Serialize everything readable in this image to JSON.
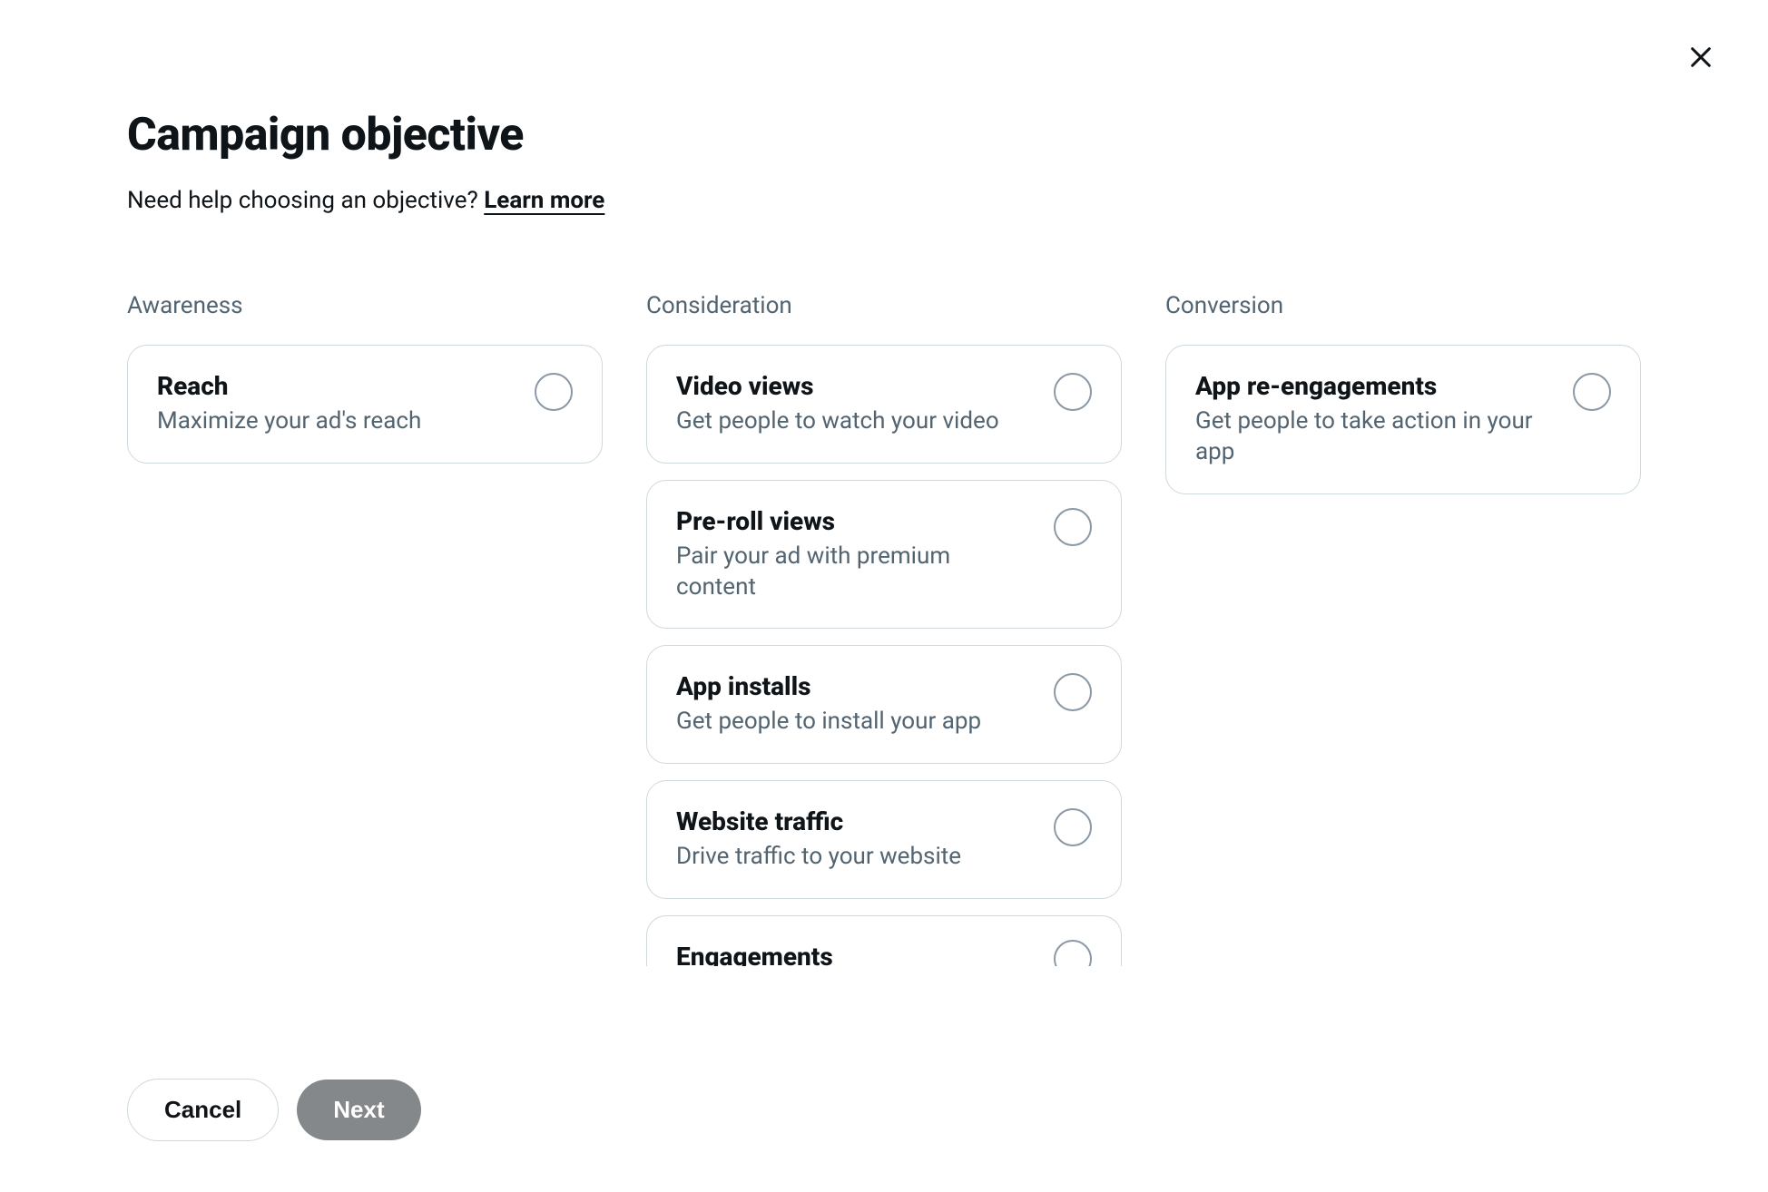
{
  "header": {
    "title": "Campaign objective",
    "help_text": "Need help choosing an objective? ",
    "learn_more": "Learn more"
  },
  "columns": [
    {
      "id": "awareness",
      "title": "Awareness",
      "options": [
        {
          "id": "reach",
          "title": "Reach",
          "description": "Maximize your ad's reach"
        }
      ]
    },
    {
      "id": "consideration",
      "title": "Consideration",
      "options": [
        {
          "id": "video-views",
          "title": "Video views",
          "description": "Get people to watch your video"
        },
        {
          "id": "pre-roll-views",
          "title": "Pre-roll views",
          "description": "Pair your ad with premium content"
        },
        {
          "id": "app-installs",
          "title": "App installs",
          "description": "Get people to install your app"
        },
        {
          "id": "website-traffic",
          "title": "Website traffic",
          "description": "Drive traffic to your website"
        },
        {
          "id": "engagements",
          "title": "Engagements",
          "description": ""
        }
      ]
    },
    {
      "id": "conversion",
      "title": "Conversion",
      "options": [
        {
          "id": "app-re-engagements",
          "title": "App re-engagements",
          "description": "Get people to take action in your app"
        }
      ]
    }
  ],
  "footer": {
    "cancel": "Cancel",
    "next": "Next"
  }
}
